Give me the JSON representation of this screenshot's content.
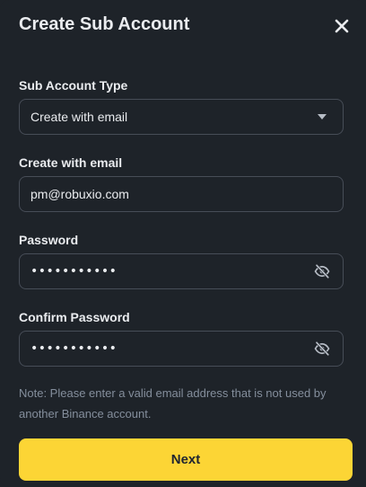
{
  "dialog": {
    "title": "Create Sub Account",
    "close_icon": "close-icon"
  },
  "form": {
    "account_type": {
      "label": "Sub Account Type",
      "value": "Create with email",
      "icon": "chevron-down-icon"
    },
    "email": {
      "label": "Create with email",
      "value": "pm@robuxio.com"
    },
    "password": {
      "label": "Password",
      "value": "•••••••••••",
      "icon": "eye-slash-icon"
    },
    "confirm_password": {
      "label": "Confirm Password",
      "value": "•••••••••••",
      "icon": "eye-slash-icon"
    },
    "note": "Note: Please enter a valid email address that is not used by another Binance account.",
    "submit_label": "Next"
  },
  "colors": {
    "background": "#1e2329",
    "border": "#474d57",
    "text": "#eaecef",
    "muted": "#848e9c",
    "accent": "#fcd535"
  }
}
